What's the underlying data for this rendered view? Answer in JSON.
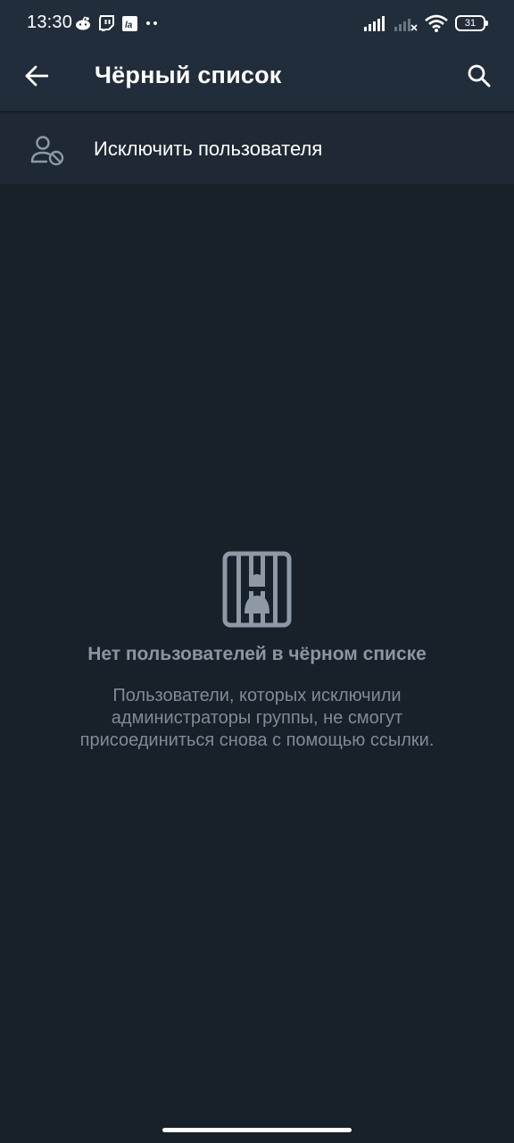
{
  "status_bar": {
    "time": "13:30",
    "battery_level": "31",
    "left_icons": [
      "reddit-icon",
      "twitch-icon",
      "lastfm-icon",
      "more-notifications-icon"
    ],
    "right_icons": [
      "signal-icon",
      "signal-no-service-icon",
      "wifi-icon",
      "battery-icon"
    ]
  },
  "app_bar": {
    "title": "Чёрный список",
    "back_icon": "back-arrow-icon",
    "search_icon": "search-icon"
  },
  "action": {
    "label": "Исключить пользователя",
    "icon": "user-block-icon"
  },
  "empty_state": {
    "icon": "jail-icon",
    "title": "Нет пользователей в чёрном списке",
    "description": "Пользователи, которых исключили администраторы группы, не смогут присоединиться снова с помощью ссылки."
  },
  "colors": {
    "background": "#182029",
    "header": "#222d3b",
    "action_row": "#1f2935",
    "muted_text": "#8a96a3",
    "icon_muted": "#8d99a6"
  }
}
